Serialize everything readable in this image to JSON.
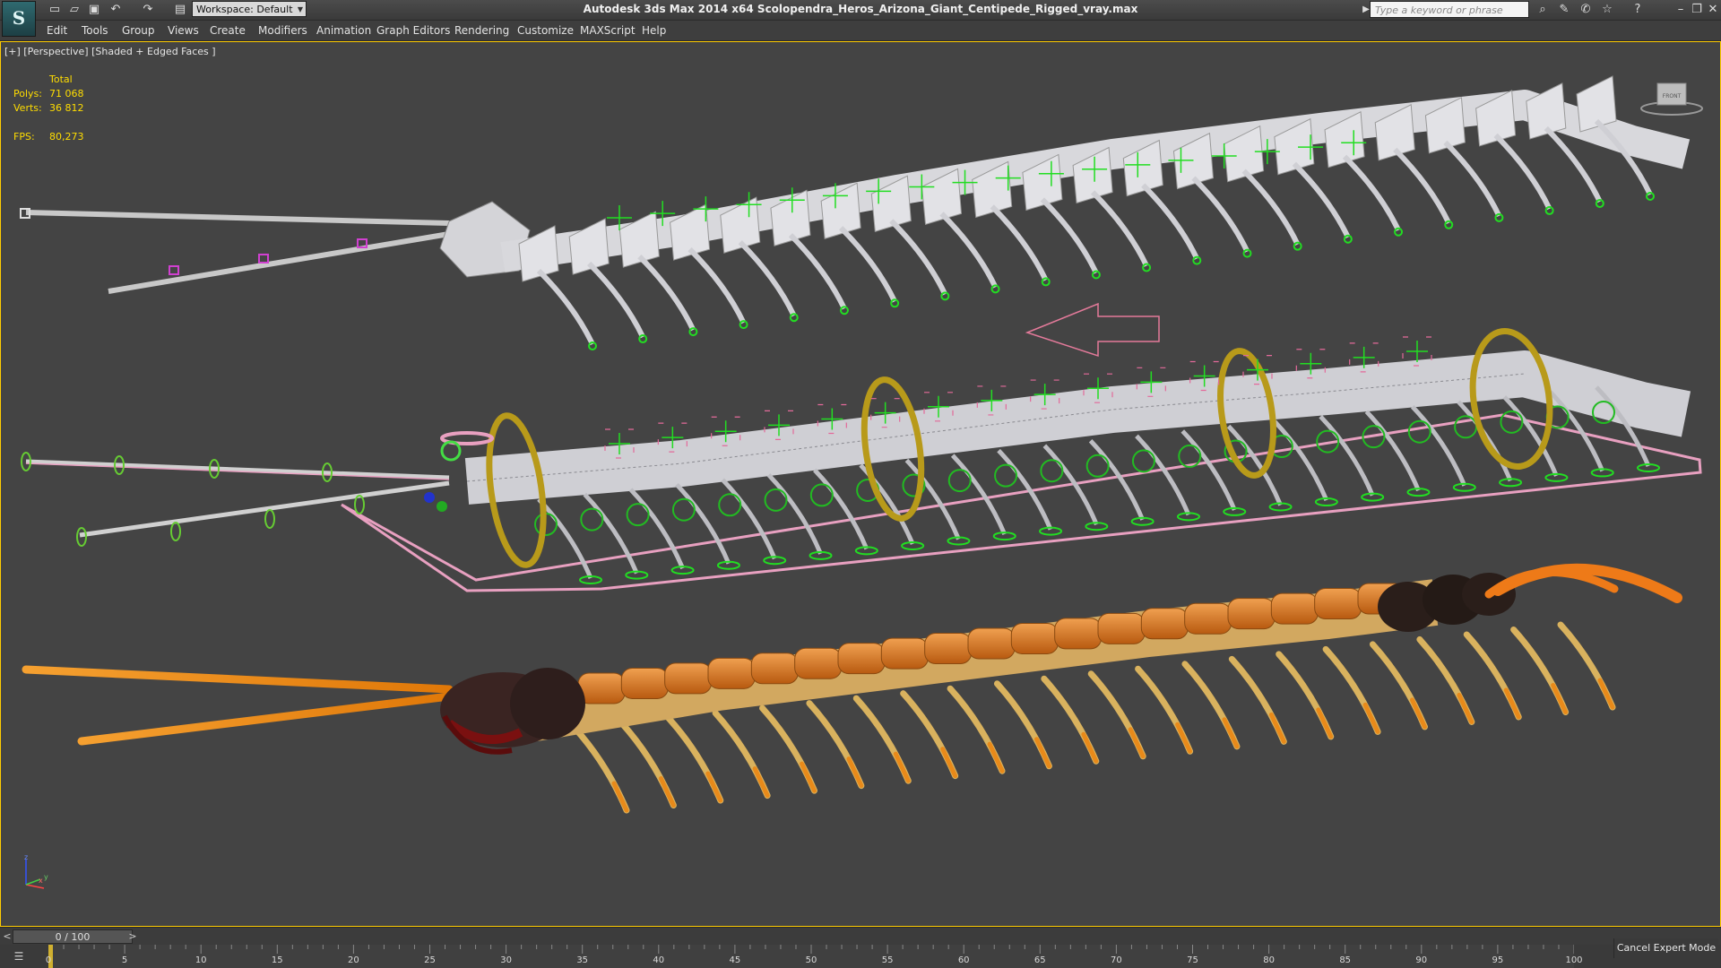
{
  "app": {
    "logo_glyph": "S",
    "window_title": "Autodesk 3ds Max  2014 x64    Scolopendra_Heros_Arizona_Giant_Centipede_Rigged_vray.max",
    "workspace": "Workspace: Default",
    "search_placeholder": "Type a keyword or phrase"
  },
  "quick_access": [
    {
      "icon": "new-file-icon",
      "glyph": "▭"
    },
    {
      "icon": "open-folder-icon",
      "glyph": "▱"
    },
    {
      "icon": "save-icon",
      "glyph": "▣"
    },
    {
      "icon": "undo-icon",
      "glyph": "↶"
    },
    {
      "icon": "redo-icon",
      "glyph": "↷"
    },
    {
      "icon": "project-folder-icon",
      "glyph": "▤"
    }
  ],
  "title_icons": [
    {
      "icon": "binoculars-icon",
      "glyph": "⌕"
    },
    {
      "icon": "subscription-icon",
      "glyph": "✎"
    },
    {
      "icon": "communication-icon",
      "glyph": "✆"
    },
    {
      "icon": "favorites-icon",
      "glyph": "☆"
    },
    {
      "icon": "help-icon",
      "glyph": "?"
    }
  ],
  "window_controls": [
    {
      "icon": "minimize-icon",
      "glyph": "–"
    },
    {
      "icon": "restore-icon",
      "glyph": "❐"
    },
    {
      "icon": "close-icon",
      "glyph": "✕"
    }
  ],
  "menu": [
    "Edit",
    "Tools",
    "Group",
    "Views",
    "Create",
    "Modifiers",
    "Animation",
    "Graph Editors",
    "Rendering",
    "Customize",
    "MAXScript",
    "Help"
  ],
  "viewport": {
    "label": "[+] [Perspective] [Shaded + Edged Faces ]",
    "stats_header": "Total",
    "polys_label": "Polys:",
    "polys_value": "71 068",
    "verts_label": "Verts:",
    "verts_value": "36 812",
    "fps_label": "FPS:",
    "fps_value": "80,273",
    "axis_labels": [
      "z",
      "x",
      "y"
    ],
    "viewcube_label": "FRONT"
  },
  "timeline": {
    "slider_value": "0 / 100",
    "prev_glyph": "<",
    "next_glyph": ">",
    "ticks": [
      "0",
      "5",
      "10",
      "15",
      "20",
      "25",
      "30",
      "35",
      "40",
      "45",
      "50",
      "55",
      "60",
      "65",
      "70",
      "75",
      "80",
      "85",
      "90",
      "95",
      "100"
    ]
  },
  "status": {
    "cancel_expert": "Cancel Expert Mode"
  },
  "colors": {
    "viewport_bg": "#444444",
    "active_border": "#ffcc00",
    "stats_text": "#ffdd00",
    "helper_green": "#22dd22",
    "ring_gold": "#b89a1a",
    "spline_pink": "#e8a0c0",
    "centipede_orange": "#e88a1a"
  }
}
